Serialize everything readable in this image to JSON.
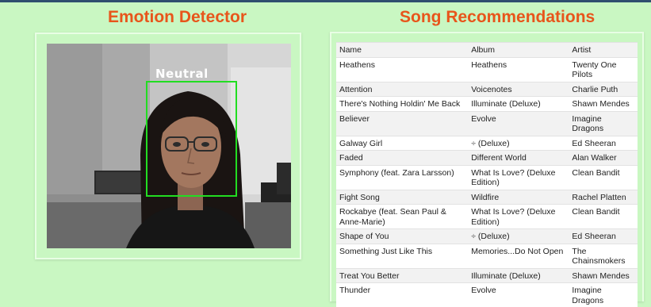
{
  "emotion_panel": {
    "title": "Emotion Detector",
    "detected_emotion": "Neutral",
    "box_color": "#22dd22"
  },
  "songs_panel": {
    "title": "Song Recommendations",
    "columns": [
      "Name",
      "Album",
      "Artist"
    ],
    "rows": [
      {
        "name": "Heathens",
        "album": "Heathens",
        "artist": "Twenty One Pilots"
      },
      {
        "name": "Attention",
        "album": "Voicenotes",
        "artist": "Charlie Puth"
      },
      {
        "name": "There's Nothing Holdin' Me Back",
        "album": "Illuminate (Deluxe)",
        "artist": "Shawn Mendes"
      },
      {
        "name": "Believer",
        "album": "Evolve",
        "artist": "Imagine Dragons"
      },
      {
        "name": "Galway Girl",
        "album": "÷ (Deluxe)",
        "artist": "Ed Sheeran"
      },
      {
        "name": "Faded",
        "album": "Different World",
        "artist": "Alan Walker"
      },
      {
        "name": "Symphony (feat. Zara Larsson)",
        "album": "What Is Love? (Deluxe Edition)",
        "artist": "Clean Bandit"
      },
      {
        "name": "Fight Song",
        "album": "Wildfire",
        "artist": "Rachel Platten"
      },
      {
        "name": "Rockabye (feat. Sean Paul & Anne-Marie)",
        "album": "What Is Love? (Deluxe Edition)",
        "artist": "Clean Bandit"
      },
      {
        "name": "Shape of You",
        "album": "÷ (Deluxe)",
        "artist": "Ed Sheeran"
      },
      {
        "name": "Something Just Like This",
        "album": "Memories...Do Not Open",
        "artist": "The Chainsmokers"
      },
      {
        "name": "Treat You Better",
        "album": "Illuminate (Deluxe)",
        "artist": "Shawn Mendes"
      },
      {
        "name": "Thunder",
        "album": "Evolve",
        "artist": "Imagine Dragons"
      }
    ]
  },
  "colors": {
    "page_background": "#c9f7c2",
    "title_color": "#e8551b",
    "top_bar": "#2f4f6f"
  }
}
